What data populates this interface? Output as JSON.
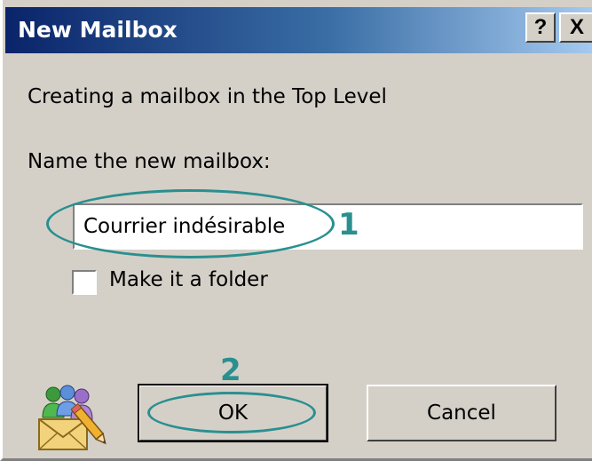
{
  "window": {
    "title": "New Mailbox",
    "help_button": "?",
    "close_button": "X"
  },
  "info_text": "Creating a mailbox in the Top Level",
  "name_label": "Name the new mailbox:",
  "name_input": {
    "value": "Courrier indésirable",
    "placeholder": ""
  },
  "folder_checkbox": {
    "label": "Make it a folder",
    "checked": false
  },
  "buttons": {
    "ok_label": "OK",
    "cancel_label": "Cancel"
  },
  "annotations": {
    "marker_1": "1",
    "marker_2": "2",
    "color": "#2a8f8f"
  },
  "icons": {
    "app_icon": "users-envelope-pencil-icon"
  },
  "colors": {
    "titlebar_start": "#0a246a",
    "titlebar_end": "#a6caf0",
    "dialog_background": "#d4d0c8"
  }
}
